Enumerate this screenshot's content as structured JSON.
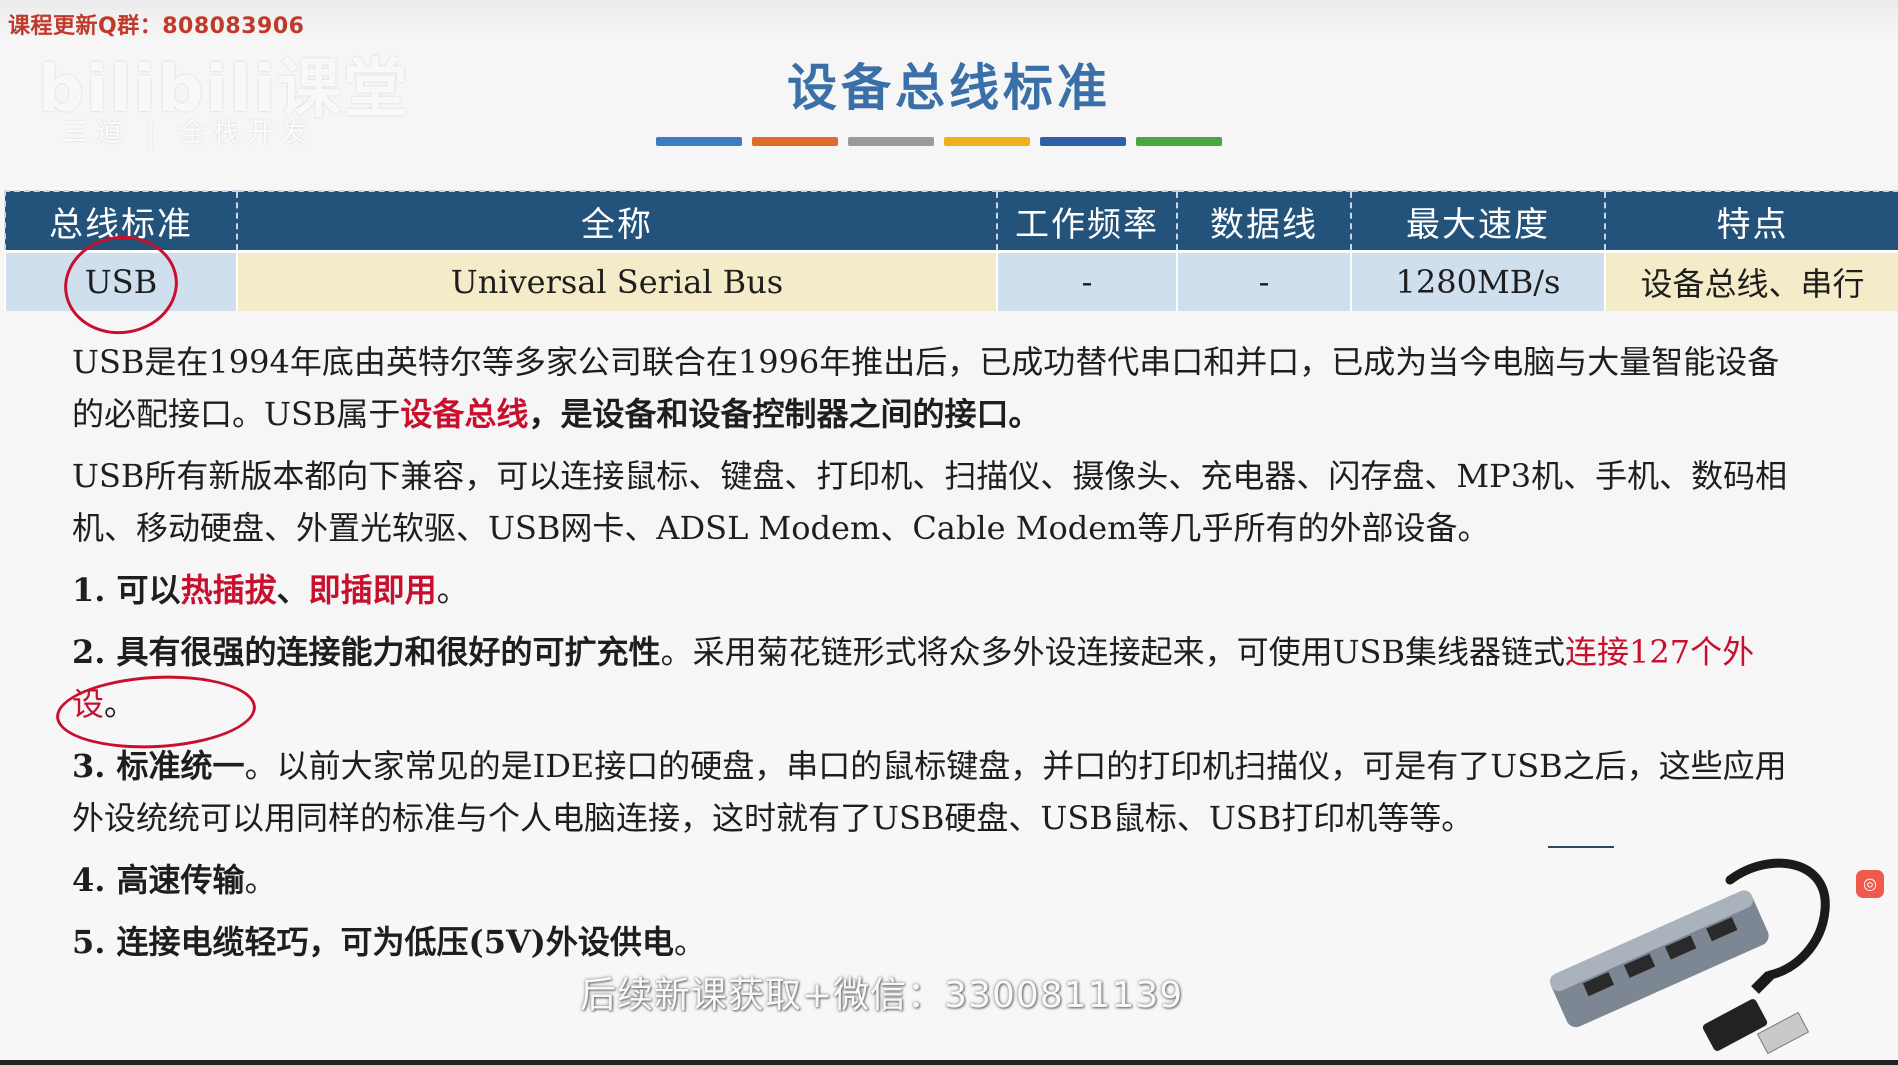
{
  "watermarks": {
    "qq_group": "课程更新Q群：808083906",
    "logo_text": "bilibili课堂",
    "logo_sub": "三道 | 全栈开发",
    "wechat": "后续新课获取+微信：3300811139"
  },
  "slide": {
    "title": "设备总线标准",
    "color_bar": [
      "#3d7cc3",
      "#e06c2c",
      "#9a9a9a",
      "#f1b11b",
      "#2f5fa8",
      "#4aa63e"
    ]
  },
  "table": {
    "headers": [
      "总线标准",
      "全称",
      "工作频率",
      "数据线",
      "最大速度",
      "特点"
    ],
    "row": [
      "USB",
      "Universal Serial Bus",
      "-",
      "-",
      "1280MB/s",
      "设备总线、串行"
    ]
  },
  "paragraphs": {
    "p1_a": "USB是在1994年底由英特尔等多家公司联合在1996年推出后，已成功替代串口和并口，已成为当今电脑与大量智能设备的必配接口。USB属于",
    "p1_red": "设备总线",
    "p1_b": "，是设备和设备控制器之间的接口。",
    "p2": "USB所有新版本都向下兼容，可以连接鼠标、键盘、打印机、扫描仪、摄像头、充电器、闪存盘、MP3机、手机、数码相机、移动硬盘、外置光软驱、USB网卡、ADSL Modem、Cable Modem等几乎所有的外部设备。",
    "item1_a": "1. 可以",
    "item1_red1": "热插拔",
    "item1_sep": "、",
    "item1_red2": "即插即用",
    "item1_end": "。",
    "item2_bold": "2. 具有很强的连接能力和很好的可扩充性",
    "item2_a": "。采用菊花链形式将众多外设连接起来，可使用USB集线器链式",
    "item2_red": "连接127个外设",
    "item2_end": "。",
    "item3_bold": "3. 标准统一",
    "item3_a": "。以前大家常见的是IDE接口的硬盘，串口的鼠标键盘，并口的打印机扫描仪，可是有了USB之后，这些应用外设统统可以用同样的标准与个人电脑连接，这时就有了USB硬盘、USB鼠标、USB打印机等等。",
    "item4_bold": "4. 高速传输",
    "item4_end": "。",
    "item5_bold": "5. 连接电缆轻巧，可为低压(5V)外设供电",
    "item5_end": "。"
  },
  "icons": {
    "hub_image": "usb-hub-icon",
    "corner_button": "assistant-icon"
  }
}
